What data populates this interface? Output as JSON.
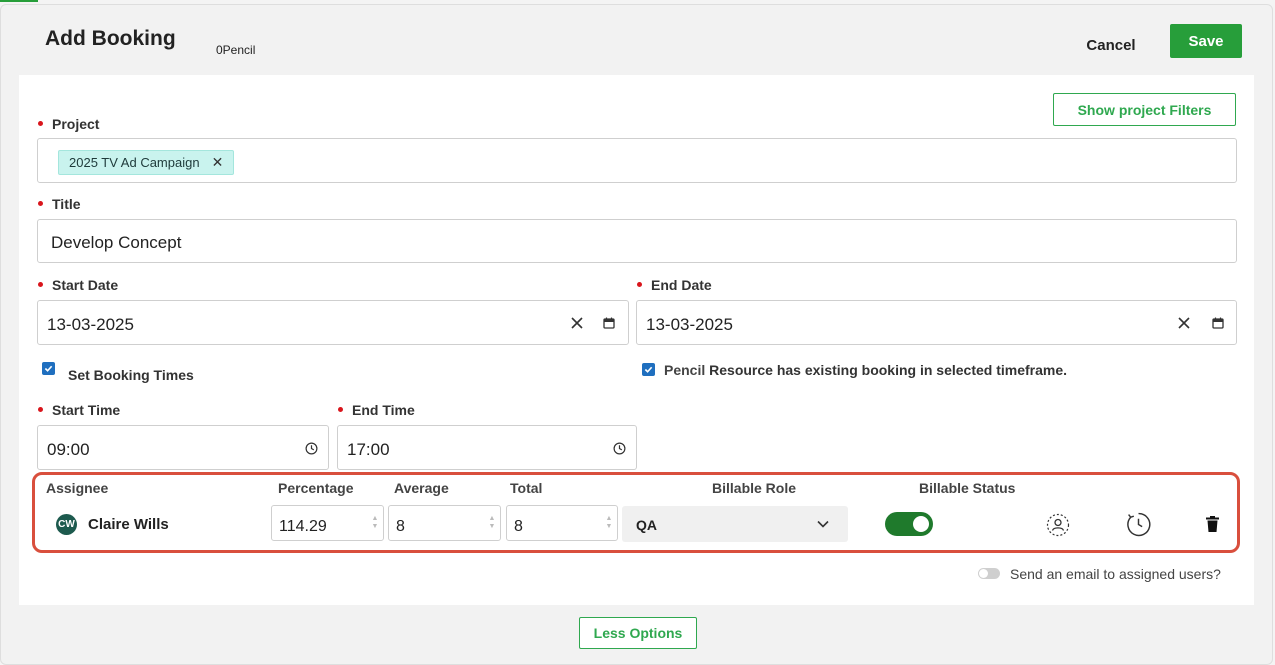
{
  "header": {
    "title": "Add Booking",
    "subtitle": "0Pencil",
    "cancel_label": "Cancel",
    "save_label": "Save"
  },
  "filters_button": "Show project Filters",
  "project": {
    "label": "Project",
    "tag": "2025 TV Ad Campaign",
    "tag_remove": "✕"
  },
  "title_field": {
    "label": "Title",
    "value": "Develop Concept"
  },
  "start_date": {
    "label": "Start Date",
    "value": "13-03-2025"
  },
  "end_date": {
    "label": "End Date",
    "value": "13-03-2025"
  },
  "set_booking_times": {
    "label": "Set Booking Times",
    "checked": true
  },
  "existing_booking": {
    "label_prefix": "Pencil",
    "label": "Resource has existing booking in selected timeframe.",
    "checked": true
  },
  "start_time": {
    "label": "Start Time",
    "value": "09:00"
  },
  "end_time": {
    "label": "End Time",
    "value": "17:00"
  },
  "assignees": {
    "columns": {
      "assignee": "Assignee",
      "percentage": "Percentage",
      "average": "Average",
      "total": "Total",
      "billable_role": "Billable Role",
      "billable_status": "Billable Status"
    },
    "rows": [
      {
        "initials": "CW",
        "name": "Claire Wills",
        "percentage": "114.29",
        "average": "8",
        "total": "8",
        "billable_role": "QA",
        "billable_status": true
      }
    ]
  },
  "send_email_label": "Send an email to assigned users?",
  "less_options_label": "Less Options",
  "colors": {
    "accent_green": "#279e3a",
    "required_red": "#d9151c",
    "highlight_frame": "#d94f3d",
    "tag_bg": "#c9f3ee",
    "checkbox_blue": "#1f6fbf"
  }
}
